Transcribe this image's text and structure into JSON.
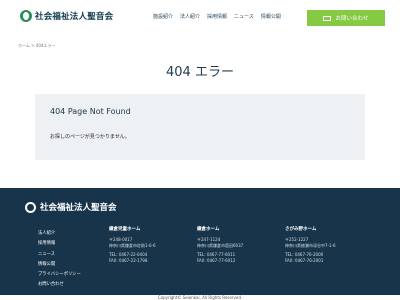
{
  "header": {
    "logo_text": "社会福祉法人聖音会",
    "nav": [
      "施設紹介",
      "法人紹介",
      "採用情報",
      "ニュース",
      "情報公開"
    ],
    "contact_label": "お問い合わせ"
  },
  "breadcrumb": "ホーム > 404エラー",
  "page_title": "404 エラー",
  "error": {
    "heading": "404 Page Not Found",
    "message": "お探しのページが見つかりません。"
  },
  "footer": {
    "logo_text": "社会福祉法人聖音会",
    "links": [
      "法人紹介",
      "採用情報",
      "ニュース",
      "情報公開",
      "プライバシーポリシー",
      "お問い合わせ"
    ],
    "col1": {
      "title": "鎌倉児童ホーム",
      "zip": "〒248-0017",
      "addr": "神奈川県鎌倉市佐助1-6-6",
      "tel": "TEL: 0467-22-0404",
      "fax": "FAX: 0467-22-1798"
    },
    "col2": {
      "title": "鎌倉ホーム",
      "zip": "〒247-1124",
      "addr": "神奈川県鎌倉市笛田6037",
      "tel": "TEL: 0467-77-6011",
      "fax": "FAX: 0467-77-6012"
    },
    "col3": {
      "title": "さがみ野ホーム",
      "zip": "〒252-1227",
      "addr": "神奈川県綾瀬市深谷中7-1-6",
      "tel": "TEL: 0467-76-2000",
      "fax": "FAX: 0467-76-2001"
    },
    "copyright": "Copyright© Seionkai, All Rights Reserved."
  }
}
